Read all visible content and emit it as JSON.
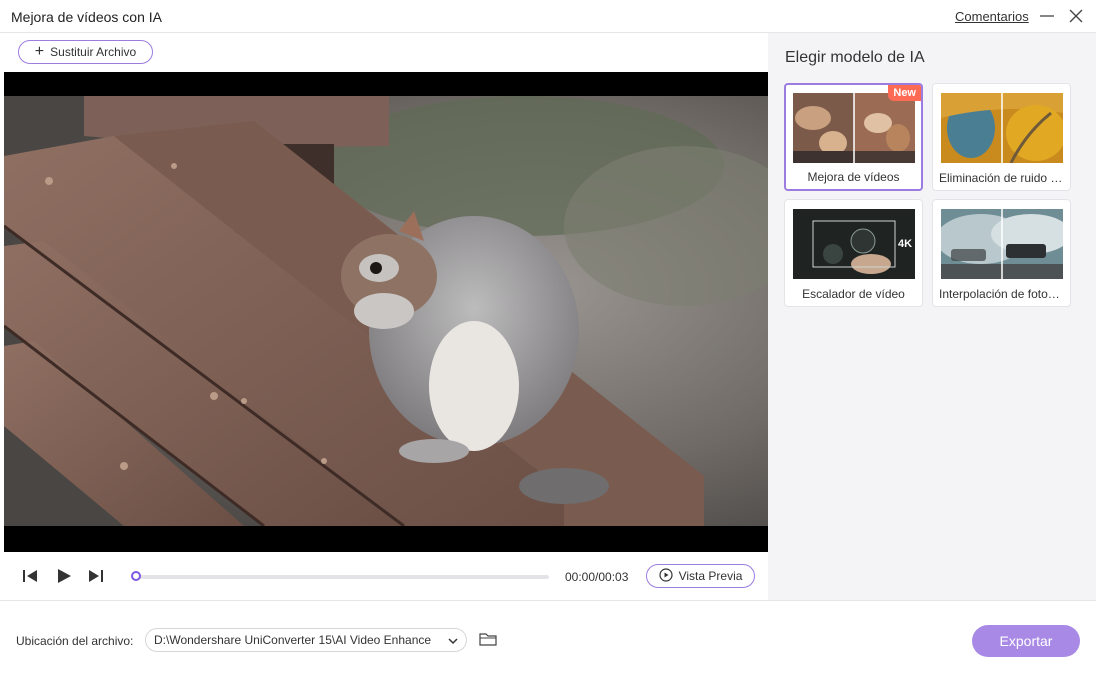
{
  "window": {
    "title": "Mejora de vídeos con IA",
    "feedback_link": "Comentarios"
  },
  "toolbar": {
    "replace_file_label": "Sustituir Archivo"
  },
  "player": {
    "current_time": "00:00",
    "duration": "00:03",
    "time_display": "00:00/00:03",
    "progress_fraction": 0.0,
    "preview_label": "Vista Previa"
  },
  "model_panel": {
    "title": "Elegir modelo de IA",
    "models": [
      {
        "label": "Mejora de vídeos",
        "badge": "New",
        "selected": true
      },
      {
        "label": "Eliminación de ruido de video",
        "badge": "",
        "selected": false
      },
      {
        "label": "Escalador de vídeo",
        "badge": "",
        "selected": false
      },
      {
        "label": "Interpolación de fotogramas",
        "badge": "",
        "selected": false
      }
    ],
    "upscaler_thumb_text": "4K"
  },
  "footer": {
    "location_label": "Ubicación del archivo:",
    "location_value": "D:\\Wondershare UniConverter 15\\AI Video Enhance",
    "export_label": "Exportar"
  },
  "colors": {
    "accent": "#9d7ce0",
    "export_bg": "#a88ae6",
    "badge": "#ff6a55",
    "panel_bg": "#f4f4f6"
  },
  "icons": {
    "minimize": "minimize-icon",
    "close": "close-icon",
    "plus": "plus-icon",
    "prev_frame": "previous-frame-icon",
    "play": "play-icon",
    "next_frame": "next-frame-icon",
    "preview": "preview-play-icon",
    "chevron": "chevron-down-icon",
    "folder": "folder-icon"
  }
}
